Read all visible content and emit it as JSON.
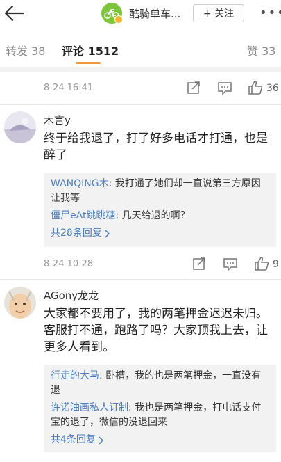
{
  "header": {
    "title": "酷骑单车...",
    "follow_label": "+ 关注",
    "more": "•••"
  },
  "tabs": {
    "repost": "转发 38",
    "comments": "评论 1512",
    "likes": "赞 33"
  },
  "top_item": {
    "time": "8-24 16:41",
    "likes": "36"
  },
  "comments": [
    {
      "user": "木言y",
      "text_line1": "终于给我退了，打了好多电话才打通，也是",
      "text_line2": "醉了",
      "replies": [
        {
          "name": "WANQING木",
          "text": ": 我打通了她们却一直说第三方原因",
          "text2": "让我等"
        },
        {
          "name": "僵尸eAt跳跳糖",
          "text": ": 几天给退的啊？"
        }
      ],
      "more_replies": "共28条回复",
      "time": "8-24 10:28",
      "likes": "9"
    },
    {
      "user": "AGony龙龙",
      "text_line1": "大家都不要用了，我的两笔押金迟迟未归。",
      "text_line2": "客服打不通，跑路了吗？大家顶我上去，让",
      "text_line3": "更多人看到。",
      "replies": [
        {
          "name": "行走的大马",
          "text": ": 卧槽，我的也是两笔押金，一直没有",
          "text2": "退"
        },
        {
          "name": "许诺油画私人订制",
          "text": ": 我也是两笔押金，打电话支付",
          "text2": "宝的退了，微信的没退回来"
        }
      ],
      "more_replies": "共4条回复"
    }
  ]
}
